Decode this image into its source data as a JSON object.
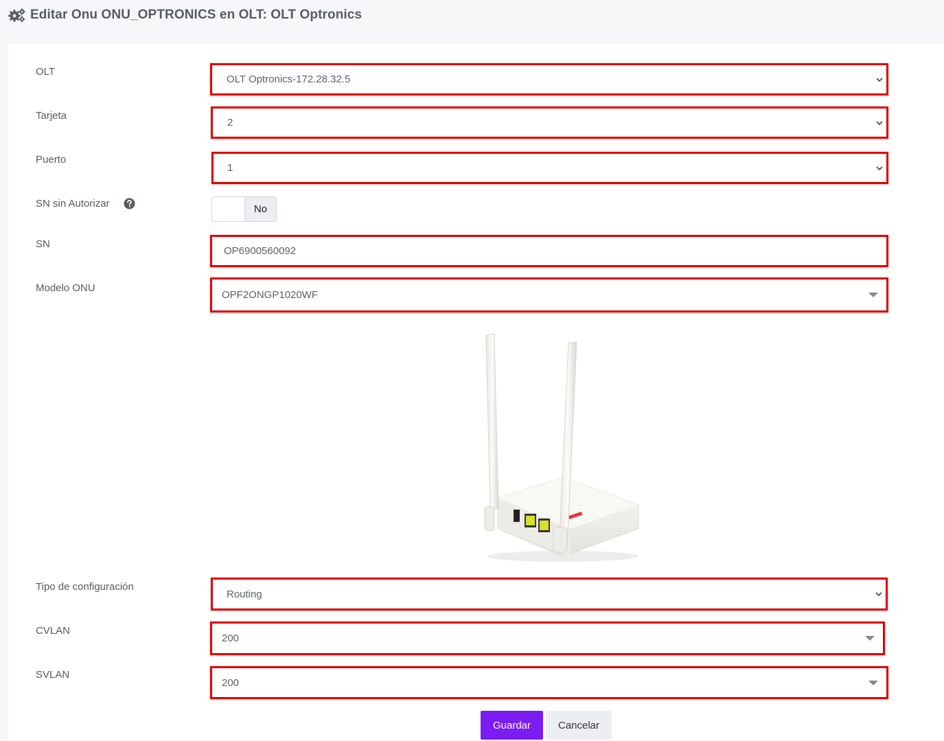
{
  "header": {
    "title": "Editar Onu ONU_OPTRONICS en OLT: OLT Optronics",
    "icon": "gears-icon"
  },
  "form": {
    "olt": {
      "label": "OLT",
      "value": "OLT Optronics-172.28.32.5"
    },
    "tarjeta": {
      "label": "Tarjeta",
      "value": "2"
    },
    "puerto": {
      "label": "Puerto",
      "value": "1"
    },
    "sn_sin_autorizar": {
      "label": "SN sin Autorizar",
      "toggle_state": "No",
      "help_icon": "question-circle-icon"
    },
    "sn": {
      "label": "SN",
      "value": "OP6900560092"
    },
    "modelo_onu": {
      "label": "Modelo ONU",
      "value": "OPF2ONGP1020WF"
    },
    "tipo_configuracion": {
      "label": "Tipo de configuración",
      "value": "Routing"
    },
    "cvlan": {
      "label": "CVLAN",
      "value": "200"
    },
    "svlan": {
      "label": "SVLAN",
      "value": "200"
    }
  },
  "buttons": {
    "save": "Guardar",
    "cancel": "Cancelar"
  },
  "colors": {
    "highlight_border": "#e00000",
    "primary_button": "#7a1cf2",
    "secondary_button": "#edeef2",
    "page_background": "#f7f7fa"
  }
}
